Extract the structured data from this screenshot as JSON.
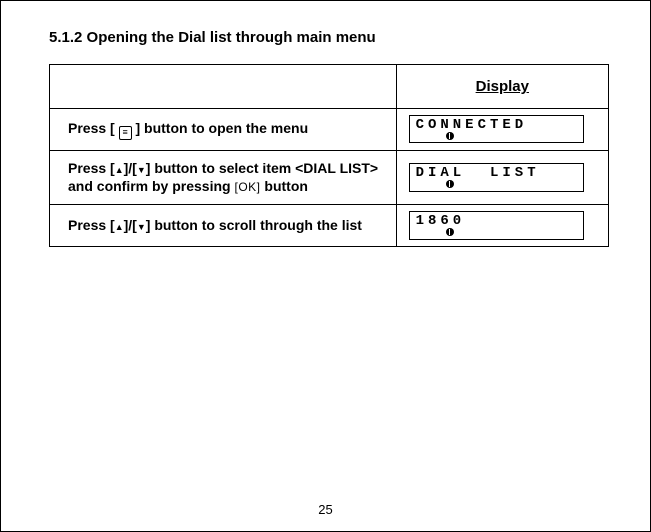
{
  "heading": "5.1.2  Opening the Dial list through main menu",
  "table": {
    "header": {
      "display": "Display"
    },
    "rows": [
      {
        "instruction_prefix": "Press [",
        "instruction_mid": "] button to open the menu",
        "lcd_line1": "CONNECTED",
        "lcd_icon": "bluetooth-icon"
      },
      {
        "instruction_part1": "Press [",
        "instruction_part2": "]/[",
        "instruction_part3": "] button to select item",
        "instruction_item": "<DIAL LIST>",
        "instruction_part4": "and confirm by pressing ",
        "instruction_ok": "[OK]",
        "instruction_part5": " button",
        "lcd_line1": "DIAL  LIST",
        "lcd_icon": "bluetooth-icon"
      },
      {
        "instruction_part1": "Press [",
        "instruction_part2": "]/[",
        "instruction_part3": "] button to scroll through the list",
        "lcd_line1": "1860",
        "lcd_icon": "bluetooth-icon"
      }
    ]
  },
  "page_number": "25"
}
